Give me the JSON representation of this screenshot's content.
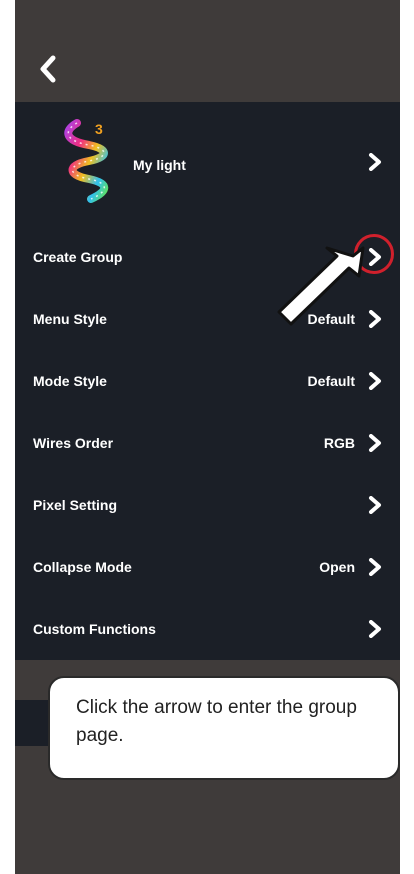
{
  "header": {
    "back_icon": "chevron-left-icon"
  },
  "device": {
    "name": "My light",
    "badge": "3",
    "logo_icon": "spiral-light-strip-icon"
  },
  "settings": [
    {
      "label": "Create Group",
      "value": ""
    },
    {
      "label": "Menu Style",
      "value": "Default"
    },
    {
      "label": "Mode Style",
      "value": "Default"
    },
    {
      "label": "Wires Order",
      "value": "RGB"
    },
    {
      "label": "Pixel Setting",
      "value": ""
    },
    {
      "label": "Collapse Mode",
      "value": "Open"
    },
    {
      "label": "Custom Functions",
      "value": ""
    }
  ],
  "tooltip": {
    "text": "Click the arrow to enter the group page."
  },
  "colors": {
    "header_bg": "#3f3b3a",
    "panel_bg": "#1b1f27",
    "highlight": "#d0202c",
    "badge": "#f0a020"
  }
}
